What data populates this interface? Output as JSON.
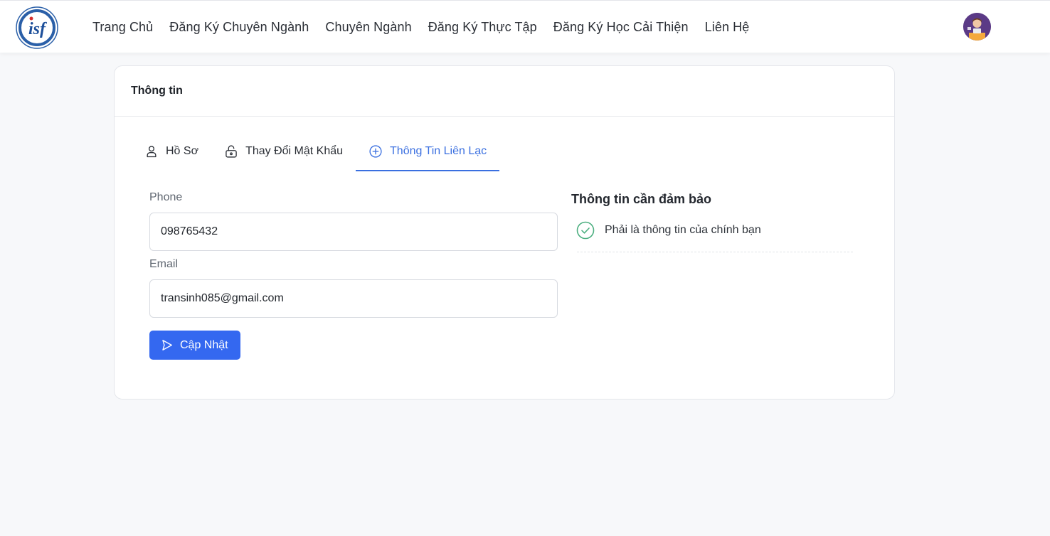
{
  "nav": {
    "items": [
      "Trang Chủ",
      "Đăng Ký Chuyên Ngành",
      "Chuyên Ngành",
      "Đăng Ký Thực Tập",
      "Đăng Ký Học Cải Thiện",
      "Liên Hệ"
    ],
    "logo_icon": "isf-university-logo",
    "avatar_icon": "user-avatar"
  },
  "card": {
    "title": "Thông tin"
  },
  "tabs": [
    {
      "label": "Hồ Sơ",
      "icon": "user-icon",
      "active": false
    },
    {
      "label": "Thay Đổi Mật Khẩu",
      "icon": "unlock-icon",
      "active": false
    },
    {
      "label": "Thông Tin Liên Lạc",
      "icon": "plus-circle-icon",
      "active": true
    }
  ],
  "form": {
    "phone_label": "Phone",
    "phone_value": "098765432",
    "email_label": "Email",
    "email_value": "transinh085@gmail.com",
    "submit_label": "Cập Nhật"
  },
  "info": {
    "title": "Thông tin cần đảm bảo",
    "items": [
      "Phải là thông tin của chính bạn"
    ]
  },
  "colors": {
    "accent": "#3468f0",
    "tab_active": "#3a6fe0",
    "check": "#4caf80"
  }
}
